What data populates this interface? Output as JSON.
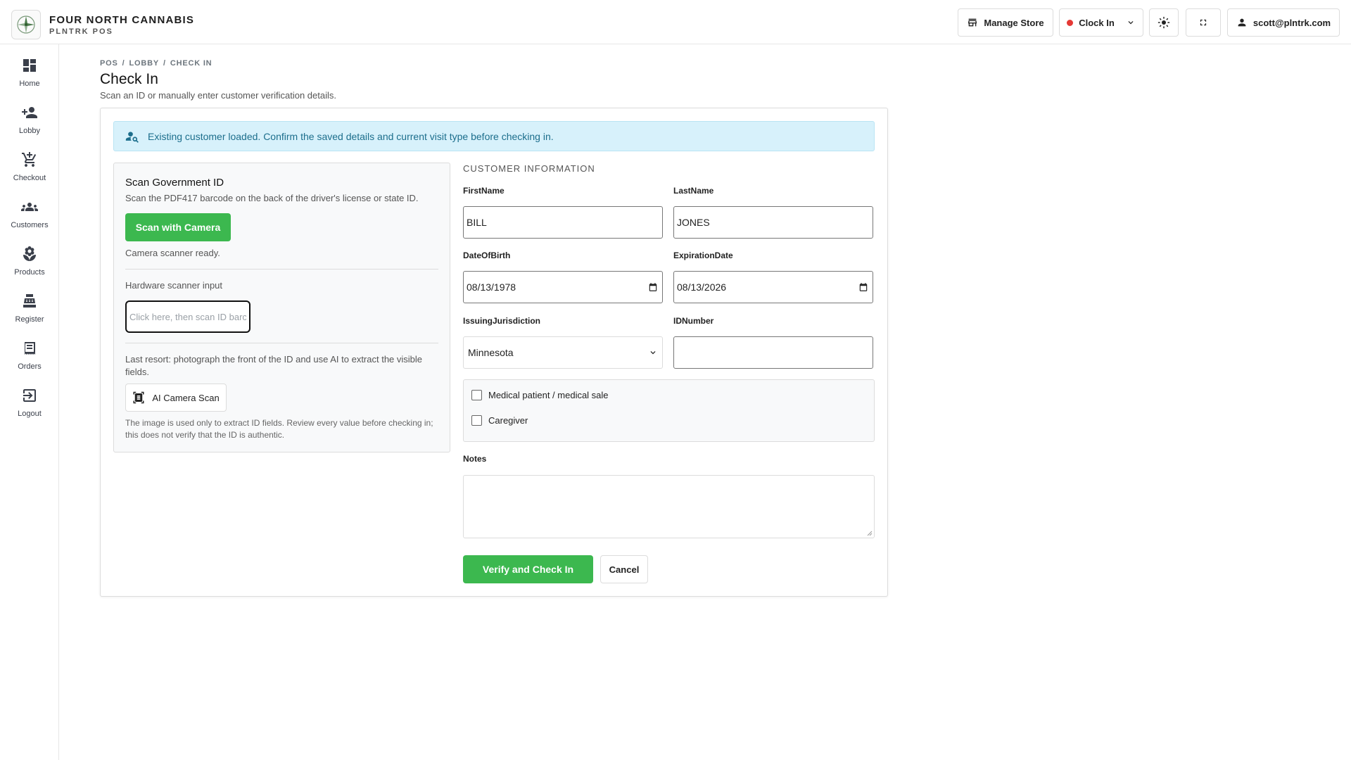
{
  "brand": {
    "name": "FOUR NORTH CANNABIS",
    "subtitle": "PLNTRK POS",
    "logo_icon": "compass-leaf-logo"
  },
  "topbar": {
    "manage_store": "Manage Store",
    "clock_in": "Clock In",
    "user_email": "scott@plntrk.com",
    "clock_status_color": "#e53935"
  },
  "sidebar": {
    "items": [
      {
        "label": "Home",
        "icon": "dashboard-icon"
      },
      {
        "label": "Lobby",
        "icon": "person-add-icon"
      },
      {
        "label": "Checkout",
        "icon": "cart-icon"
      },
      {
        "label": "Customers",
        "icon": "group-icon"
      },
      {
        "label": "Products",
        "icon": "flower-icon"
      },
      {
        "label": "Register",
        "icon": "register-icon"
      },
      {
        "label": "Orders",
        "icon": "receipt-icon"
      },
      {
        "label": "Logout",
        "icon": "logout-icon"
      }
    ]
  },
  "breadcrumb": [
    "POS",
    "LOBBY",
    "CHECK IN"
  ],
  "page": {
    "title": "Check In",
    "subtitle": "Scan an ID or manually enter customer verification details."
  },
  "alert": {
    "text": "Existing customer loaded. Confirm the saved details and current visit type before checking in."
  },
  "scan": {
    "title": "Scan Government ID",
    "description": "Scan the PDF417 barcode on the back of the driver's license or state ID.",
    "camera_button": "Scan with Camera",
    "status": "Camera scanner ready.",
    "hardware_label": "Hardware scanner input",
    "hardware_placeholder": "Click here, then scan ID barcode",
    "last_resort": "Last resort: photograph the front of the ID and use AI to extract the visible fields.",
    "ai_button": "AI Camera Scan",
    "disclaimer": "The image is used only to extract ID fields. Review every value before checking in; this does not verify that the ID is authentic."
  },
  "form": {
    "section_label": "CUSTOMER INFORMATION",
    "first_name_label": "FirstName",
    "first_name": "BILL",
    "last_name_label": "LastName",
    "last_name": "JONES",
    "dob_label": "DateOfBirth",
    "dob": "08/13/1978",
    "expiration_label": "ExpirationDate",
    "expiration": "08/13/2026",
    "jurisdiction_label": "IssuingJurisdiction",
    "jurisdiction": "Minnesota",
    "id_number_label": "IDNumber",
    "id_number": "",
    "medical_label": "Medical patient / medical sale",
    "medical_checked": false,
    "caregiver_label": "Caregiver",
    "caregiver_checked": false,
    "notes_label": "Notes",
    "notes": ""
  },
  "actions": {
    "submit": "Verify and Check In",
    "cancel": "Cancel"
  },
  "colors": {
    "accent_green": "#3cb84f",
    "alert_bg": "#d7f1fb",
    "alert_text": "#1c6e8c"
  }
}
